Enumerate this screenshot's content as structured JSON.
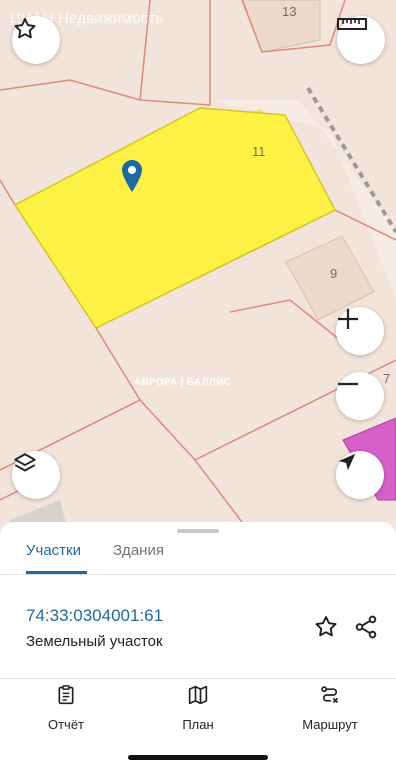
{
  "map": {
    "watermark": "ЦИАН Недвижимость",
    "parcel_labels": [
      "13",
      "11",
      "9",
      "7"
    ],
    "credit": "АВРОРА | БАЛЛИС",
    "colors": {
      "background": "#f2e4da",
      "parcel_border": "#e08a7a",
      "selected_parcel": "#fff23a",
      "building": "#edd8cc",
      "magenta_zone": "#d65fc8",
      "pin": "#1b6aa8"
    }
  },
  "controls": {
    "favorite_icon": "star-outline-icon",
    "ruler_icon": "ruler-icon",
    "zoom_in_icon": "plus-icon",
    "zoom_out_icon": "minus-icon",
    "layers_icon": "layers-icon",
    "locate_icon": "navigation-arrow-icon"
  },
  "sheet": {
    "tabs": [
      {
        "label": "Участки",
        "active": true
      },
      {
        "label": "Здания",
        "active": false
      }
    ],
    "item": {
      "cadastral_number": "74:33:0304001:61",
      "type": "Земельный участок"
    },
    "bottom_nav": [
      {
        "label": "Отчёт",
        "icon": "report-icon"
      },
      {
        "label": "План",
        "icon": "map-icon"
      },
      {
        "label": "Маршрут",
        "icon": "route-icon"
      }
    ],
    "accent_color": "#1b6aa8"
  }
}
